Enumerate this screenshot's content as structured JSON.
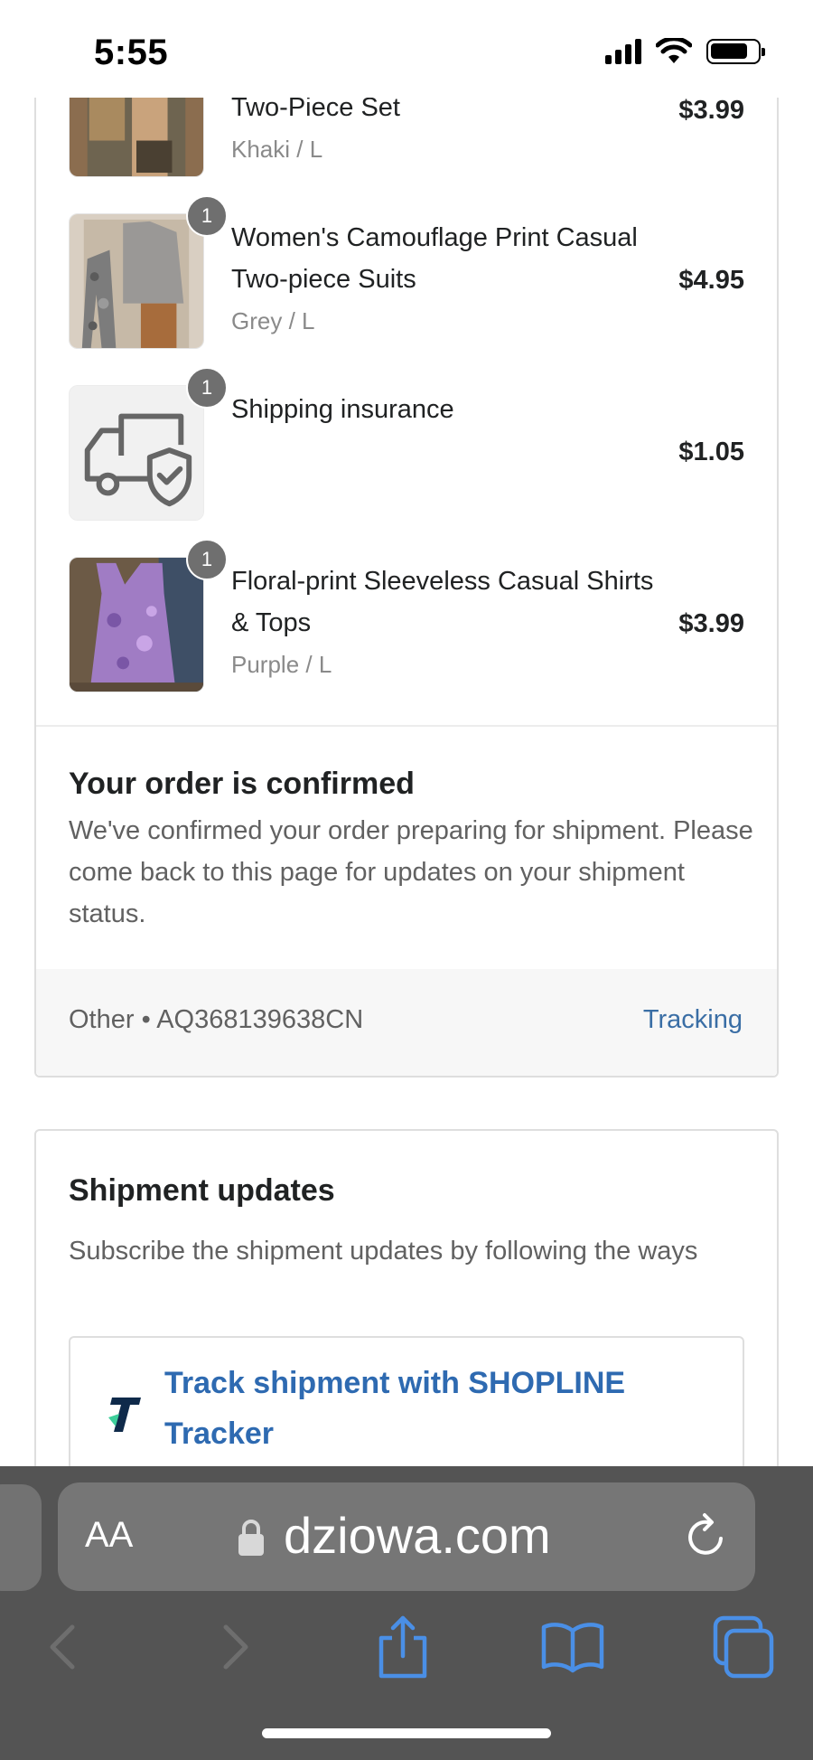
{
  "status_bar": {
    "time": "5:55"
  },
  "order_items": [
    {
      "title": "Two-Piece Set",
      "variant": "Khaki / L",
      "price": "$3.99",
      "quantity": ""
    },
    {
      "title": "Women's Camouflage Print Casual Two-piece Suits",
      "variant": "Grey / L",
      "price": "$4.95",
      "quantity": "1"
    },
    {
      "title": "Shipping insurance",
      "variant": "",
      "price": "$1.05",
      "quantity": "1"
    },
    {
      "title": "Floral-print Sleeveless Casual Shirts & Tops",
      "variant": "Purple / L",
      "price": "$3.99",
      "quantity": "1"
    }
  ],
  "confirmation": {
    "title": "Your order is confirmed",
    "text": "We've confirmed your order preparing for shipment. Please come back to this page for updates on your shipment status."
  },
  "tracking": {
    "carrier_line": "Other • AQ368139638CN",
    "link_label": "Tracking"
  },
  "shipment_updates": {
    "title": "Shipment updates",
    "text": "Subscribe the shipment updates by following the ways",
    "tracker_label": "Track shipment with SHOPLINE Tracker"
  },
  "browser": {
    "aa_label": "AA",
    "domain": "dziowa.com"
  },
  "colors": {
    "link": "#3a6ea5",
    "tracker_link": "#2e6ab1",
    "toolbar_bg": "#545454",
    "toolbar_icon": "#4a8fe6"
  },
  "icons": [
    "lock-icon",
    "reload-icon",
    "back-icon",
    "forward-icon",
    "share-icon",
    "bookmarks-icon",
    "tabs-icon",
    "truck-shield-icon"
  ]
}
